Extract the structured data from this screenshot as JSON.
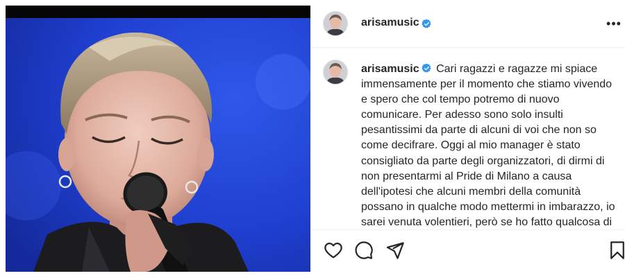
{
  "post": {
    "image_alt": "Singer with short hair singing into a microphone with eyes closed, blue background",
    "user": {
      "username": "arisamusic",
      "verified": true
    },
    "caption_text": "Cari ragazzi e ragazze mi spiace immensamente per il momento che stiamo vivendo e spero che col tempo potremo di nuovo comunicare. Per adesso sono solo insulti pesantissimi da parte di alcuni di voi che non so come decifrare. Oggi al mio manager è stato consigliato da parte degli organizzatori, di dirmi di non presentarmi al Pride di Milano a causa dell'ipotesi che alcuni membri della comunità possano in qualche modo mettermi in imbarazzo, io sarei venuta volentieri, però se ho fatto qualcosa di così tanto grave da meritare un",
    "more_label": "•••"
  },
  "colors": {
    "verified_blue": "#3897f0",
    "text": "#262626",
    "border": "#efefef"
  },
  "icons": [
    "heart-icon",
    "comment-icon",
    "share-icon",
    "bookmark-icon",
    "verified-badge-icon",
    "more-options-icon"
  ]
}
